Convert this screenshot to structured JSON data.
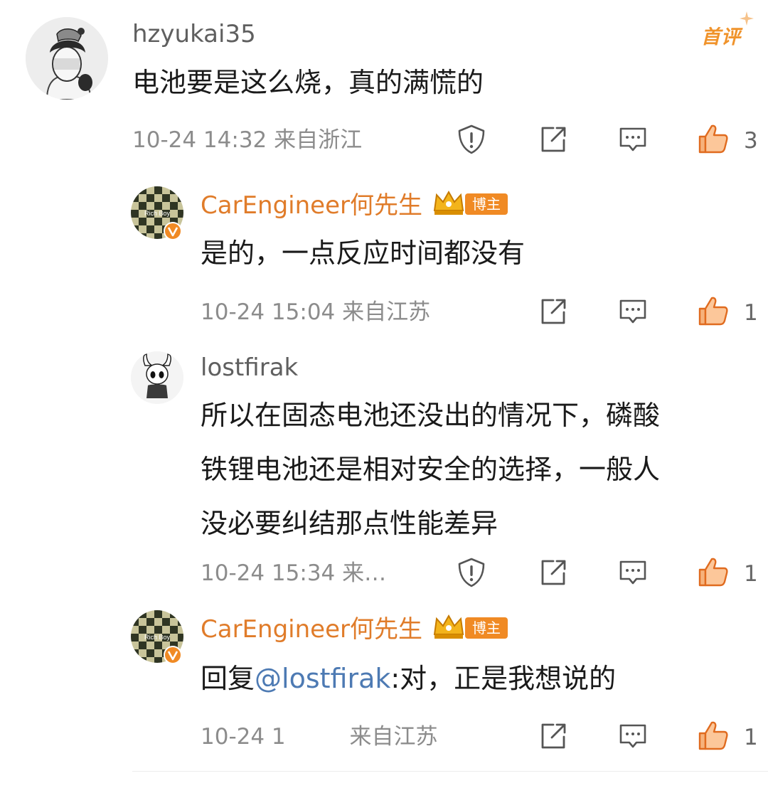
{
  "comment": {
    "username": "hzyukai35",
    "badge": "首评",
    "text": "电池要是这么烧，真的满慌的",
    "meta": "10-24 14:32 来自浙江",
    "likes": "3"
  },
  "replies": [
    {
      "username": "CarEngineer何先生",
      "avatar_label": "Rich Boy",
      "host_badge": "博主",
      "text": "是的，一点反应时间都没有",
      "meta": "10-24 15:04 来自江苏",
      "likes": "1"
    },
    {
      "username": "lostfirak",
      "text_lines": [
        "所以在固态电池还没出的情况下，磷酸",
        "铁锂电池还是相对安全的选择，一般人",
        "没必要纠结那点性能差异"
      ],
      "meta": "10-24 15:34 来…",
      "likes": "1"
    },
    {
      "username": "CarEngineer何先生",
      "avatar_label": "Rich Boy",
      "host_badge": "博主",
      "text_prefix": "回复",
      "mention": "@lostfirak",
      "text_suffix": ":对，正是我想说的",
      "meta_date": "10-24 1",
      "meta_region": "来自江苏",
      "likes": "1"
    }
  ],
  "colors": {
    "accent": "#f08a24",
    "mention": "#4d7ab3",
    "like": "#f0a060"
  }
}
